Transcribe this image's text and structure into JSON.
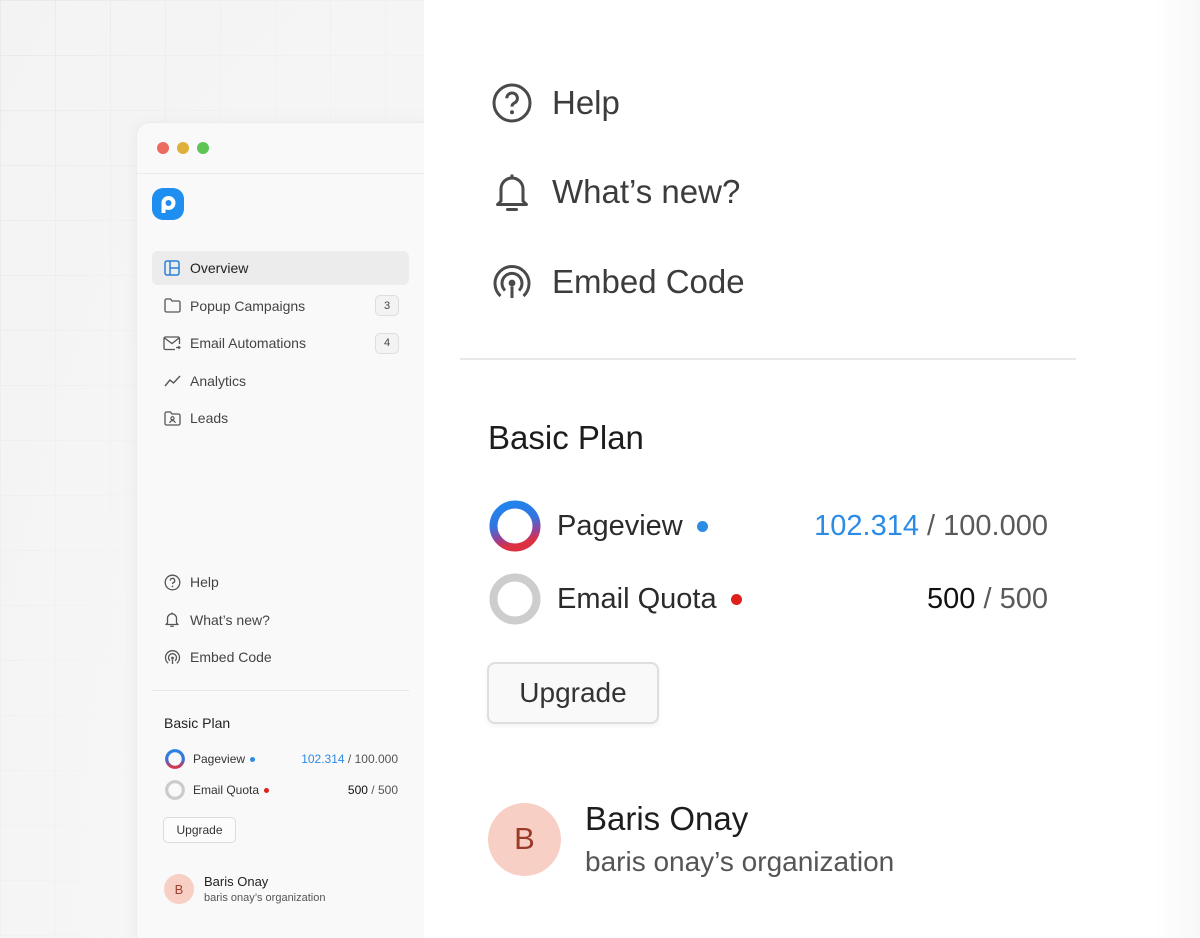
{
  "nav": {
    "items": [
      {
        "label": "Overview"
      },
      {
        "label": "Popup Campaigns",
        "badge": "3"
      },
      {
        "label": "Email Automations",
        "badge": "4"
      },
      {
        "label": "Analytics"
      },
      {
        "label": "Leads"
      }
    ]
  },
  "support": {
    "help": "Help",
    "whats_new": "What’s new?",
    "embed_code": "Embed Code"
  },
  "plan": {
    "title": "Basic Plan",
    "pageview": {
      "label": "Pageview",
      "used": "102.314",
      "limit": "100.000",
      "used_color": "#2b8be5",
      "dot_color": "#2b8be5"
    },
    "email_quota": {
      "label": "Email Quota",
      "used": "500",
      "limit": "500",
      "used_color": "#111111",
      "dot_color": "#e0201a"
    },
    "upgrade_label": "Upgrade"
  },
  "user": {
    "initial": "B",
    "name": "Baris Onay",
    "org": "baris onay’s organization"
  },
  "icons": {
    "logo": "app-logo",
    "overview": "layout-icon",
    "popup": "folder-icon",
    "email": "mail-icon",
    "analytics": "trend-line-icon",
    "leads": "contact-folder-icon",
    "help": "help-circle-icon",
    "whats_new": "bell-icon",
    "embed_code": "broadcast-icon"
  }
}
